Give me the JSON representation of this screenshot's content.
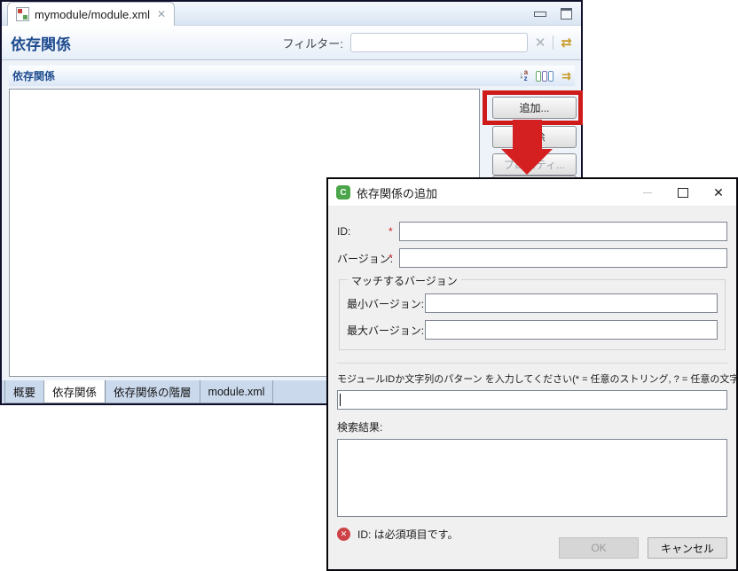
{
  "editor": {
    "tab_title": "mymodule/module.xml",
    "page_title": "依存関係",
    "filter_label": "フィルター:",
    "filter_value": "",
    "section_title": "依存関係",
    "buttons": {
      "add": "追加...",
      "remove": "削除",
      "properties": "プロパティ..."
    },
    "sort_icon": {
      "a": "a",
      "z": "z",
      "arrow": "↓"
    },
    "sync_glyph": "⇄",
    "expand_glyph": "⇉",
    "clear_glyph": "✕",
    "tab_close_glyph": "✕",
    "bottom_tabs": [
      "概要",
      "依存関係",
      "依存関係の階層",
      "module.xml"
    ],
    "bottom_tabs_active": "依存関係"
  },
  "dialog": {
    "title": "依存関係の追加",
    "icon_glyph": "C",
    "fields": {
      "id_label": "ID:",
      "version_label": "バージョン:",
      "required_marker": "*",
      "id_value": "",
      "version_value": "",
      "group_title": "マッチするバージョン",
      "min_version_label": "最小バージョン:",
      "max_version_label": "最大バージョン:",
      "min_version_value": "",
      "max_version_value": "",
      "pattern_instruction": "モジュールIDか文字列のパターン を入力してください(* = 任意のストリング, ? = 任意の文字):",
      "pattern_value": "",
      "results_label": "検索結果:"
    },
    "error": {
      "glyph": "✕",
      "message": "ID: は必須項目です。"
    },
    "buttons": {
      "ok": "OK",
      "cancel": "キャンセル"
    },
    "controls": {
      "close_glyph": "✕"
    }
  },
  "colors": {
    "highlight_red": "#cf1a1a",
    "arrow_red": "#d42020",
    "title_blue": "#1e4c8f",
    "dialog_icon_green": "#4ba54b",
    "error_red": "#cd4246",
    "required_red": "#cc2222"
  }
}
